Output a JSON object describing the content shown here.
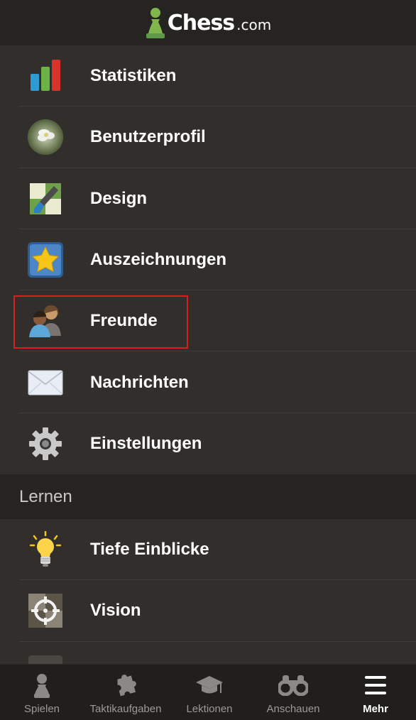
{
  "header": {
    "logo_main": "Chess",
    "logo_suffix": ".com"
  },
  "menu": {
    "items": [
      {
        "label": "Statistiken",
        "icon": "stats-bar-chart-icon"
      },
      {
        "label": "Benutzerprofil",
        "icon": "profile-avatar-flower-icon"
      },
      {
        "label": "Design",
        "icon": "paintbrush-board-icon"
      },
      {
        "label": "Auszeichnungen",
        "icon": "star-badge-icon"
      },
      {
        "label": "Freunde",
        "icon": "friends-icon"
      },
      {
        "label": "Nachrichten",
        "icon": "envelope-icon"
      },
      {
        "label": "Einstellungen",
        "icon": "gear-icon"
      }
    ]
  },
  "section_learn": {
    "title": "Lernen",
    "items": [
      {
        "label": "Tiefe Einblicke",
        "icon": "lightbulb-icon"
      },
      {
        "label": "Vision",
        "icon": "crosshair-icon"
      }
    ]
  },
  "tabbar": {
    "tabs": [
      {
        "label": "Spielen",
        "icon": "pawn-icon"
      },
      {
        "label": "Taktikaufgaben",
        "icon": "puzzle-icon"
      },
      {
        "label": "Lektionen",
        "icon": "graduation-cap-icon"
      },
      {
        "label": "Anschauen",
        "icon": "binoculars-icon"
      },
      {
        "label": "Mehr",
        "icon": "hamburger-menu-icon"
      }
    ],
    "active": "Mehr"
  },
  "colors": {
    "accent_green": "#81b64c",
    "highlight_red": "#d81f1f",
    "background": "#312e2b"
  }
}
